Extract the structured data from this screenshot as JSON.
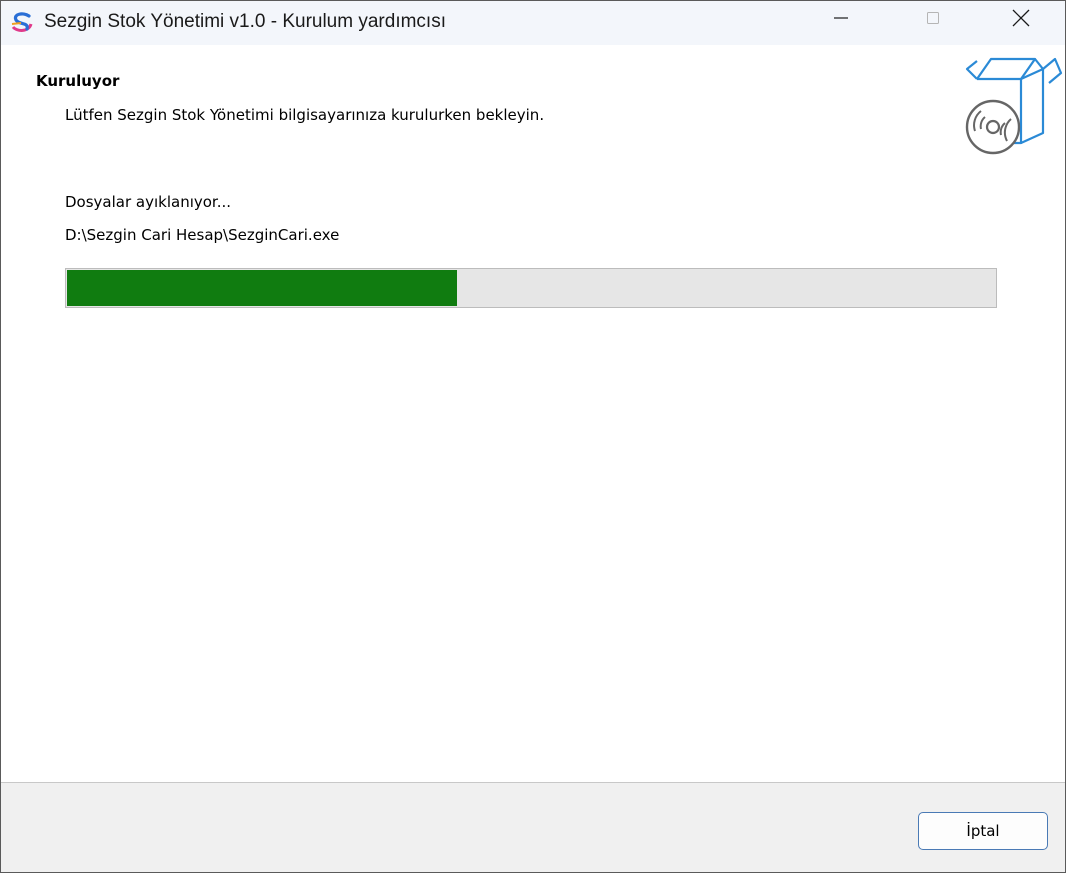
{
  "window": {
    "title": "Sezgin Stok Yönetimi v1.0 - Kurulum yardımcısı",
    "app_icon": "app-logo-icon"
  },
  "caption_buttons": {
    "minimize_icon": "minimize-icon",
    "maximize_icon": "maximize-icon",
    "close_icon": "close-icon"
  },
  "header": {
    "title": "Kuruluyor",
    "subtitle": "Lütfen Sezgin Stok Yönetimi bilgisayarınıza kurulurken bekleyin.",
    "icon": "setup-box-disc-icon"
  },
  "status": {
    "text": "Dosyalar ayıklanıyor...",
    "current_file": "D:\\Sezgin Cari Hesap\\SezginCari.exe"
  },
  "progress": {
    "percent": 42,
    "fill_color": "#107c10",
    "track_color": "#e6e6e6"
  },
  "footer": {
    "cancel_label": "İptal"
  }
}
